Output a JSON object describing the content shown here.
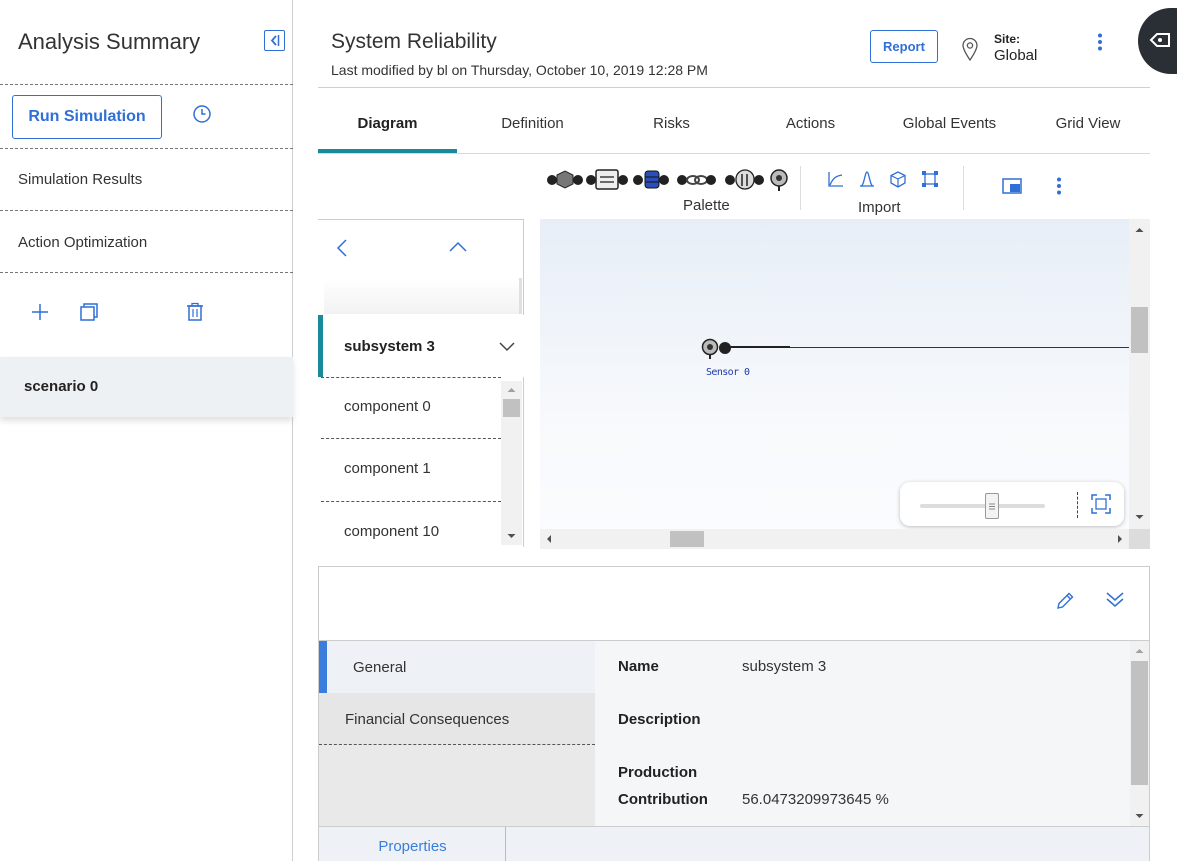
{
  "sidebar": {
    "title": "Analysis Summary",
    "run_button": "Run Simulation",
    "items": [
      {
        "label": "Simulation Results"
      },
      {
        "label": "Action Optimization"
      }
    ],
    "scenario": "scenario 0"
  },
  "header": {
    "title": "System Reliability",
    "subtitle": "Last modified by bl on Thursday, October 10, 2019 12:28 PM",
    "report_button": "Report",
    "site_label": "Site:",
    "site_value": "Global"
  },
  "tabs": [
    {
      "label": "Diagram",
      "active": true
    },
    {
      "label": "Definition",
      "active": false
    },
    {
      "label": "Risks",
      "active": false
    },
    {
      "label": "Actions",
      "active": false
    },
    {
      "label": "Global Events",
      "active": false
    },
    {
      "label": "Grid View",
      "active": false
    }
  ],
  "toolbar": {
    "palette_label": "Palette",
    "import_label": "Import"
  },
  "tree": {
    "selected": "subsystem 3",
    "items": [
      {
        "label": "component 0"
      },
      {
        "label": "component 1"
      },
      {
        "label": "component 10"
      }
    ]
  },
  "canvas": {
    "node_label": "Sensor 0"
  },
  "details": {
    "categories": [
      {
        "label": "General",
        "active": true
      },
      {
        "label": "Financial Consequences",
        "active": false
      }
    ],
    "properties": [
      {
        "key": "Name",
        "value": "subsystem 3"
      },
      {
        "key": "Description",
        "value": ""
      },
      {
        "key_line1": "Production",
        "key_line2": "Contribution",
        "value": "56.0473209973645 %"
      }
    ],
    "bottom_tab": "Properties"
  },
  "colors": {
    "accent_blue": "#2f6fd6",
    "tab_teal": "#1a8a9b",
    "category_blue": "#3b7ddd"
  }
}
